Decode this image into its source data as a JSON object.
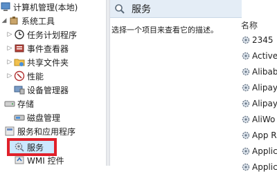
{
  "window": {
    "root_title": "计算机管理(本地)"
  },
  "tree": {
    "system_tools": "系统工具",
    "task_scheduler": "任务计划程序",
    "event_viewer": "事件查看器",
    "shared_folders": "共享文件夹",
    "performance": "性能",
    "device_manager": "设备管理器",
    "storage": "存储",
    "disk_management": "磁盘管理",
    "services_apps": "服务和应用程序",
    "services": "服务",
    "wmi_control": "WMI 控件"
  },
  "main": {
    "header_title": "服务",
    "description": "选择一个项目来查看它的描述。",
    "column_name": "名称",
    "services": [
      "2345",
      "Active",
      "Alibab",
      "Alipay",
      "Alipay",
      "AliWo",
      "App R",
      "Applic",
      "Applic"
    ]
  },
  "colors": {
    "highlight": "#e0202a",
    "selection": "#cce8ff",
    "header_bg": "#e4edf6"
  }
}
